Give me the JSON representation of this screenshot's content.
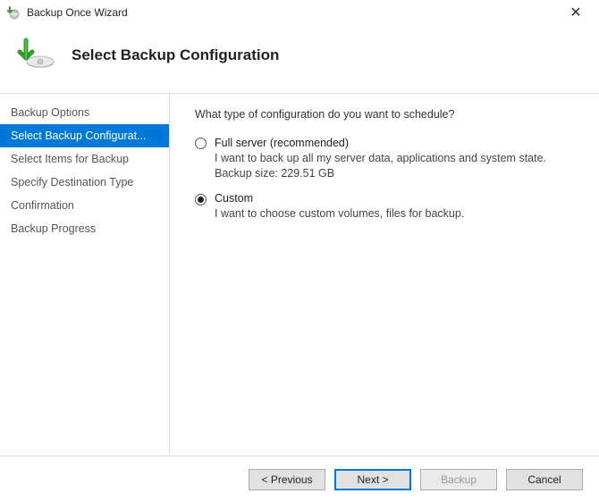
{
  "window": {
    "title": "Backup Once Wizard",
    "close_symbol": "✕"
  },
  "header": {
    "heading": "Select Backup Configuration"
  },
  "sidebar": {
    "items": [
      {
        "label": "Backup Options",
        "active": false
      },
      {
        "label": "Select Backup Configurat...",
        "active": true
      },
      {
        "label": "Select Items for Backup",
        "active": false
      },
      {
        "label": "Specify Destination Type",
        "active": false
      },
      {
        "label": "Confirmation",
        "active": false
      },
      {
        "label": "Backup Progress",
        "active": false
      }
    ]
  },
  "content": {
    "prompt": "What type of configuration do you want to schedule?",
    "options": [
      {
        "id": "full-server",
        "label": "Full server (recommended)",
        "desc": "I want to back up all my server data, applications and system state.",
        "extra": "Backup size: 229.51 GB",
        "checked": false
      },
      {
        "id": "custom",
        "label": "Custom",
        "desc": "I want to choose custom volumes, files for backup.",
        "extra": "",
        "checked": true
      }
    ]
  },
  "footer": {
    "previous": "<  Previous",
    "next": "Next  >",
    "backup": "Backup",
    "cancel": "Cancel"
  }
}
